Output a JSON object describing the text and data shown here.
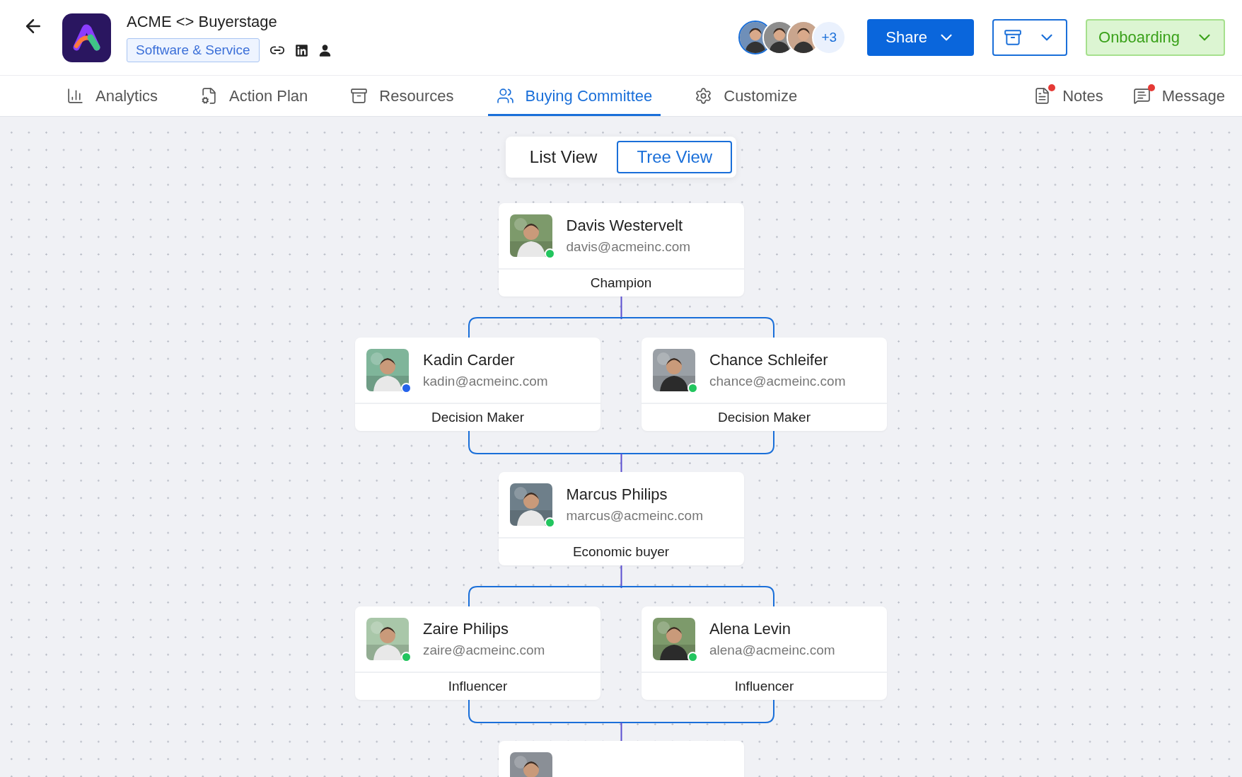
{
  "header": {
    "title": "ACME <> Buyerstage",
    "tag": "Software & Service",
    "collaborators": [
      {
        "kind": "picture"
      },
      {
        "kind": "picture"
      },
      {
        "kind": "picture"
      }
    ],
    "collaborators_more": "+3",
    "share_button": "Share",
    "stage_button": "Onboarding"
  },
  "tabs": [
    {
      "kind": "analytics",
      "label": "Analytics",
      "selected": false
    },
    {
      "kind": "plan",
      "label": "Action Plan",
      "selected": false
    },
    {
      "kind": "resources",
      "label": "Resources",
      "selected": false
    },
    {
      "kind": "committee",
      "label": "Buying Committee",
      "selected": true
    },
    {
      "kind": "customize",
      "label": "Customize",
      "selected": false
    }
  ],
  "side_tabs": [
    {
      "kind": "notes",
      "label": "Notes",
      "unread": true
    },
    {
      "kind": "message",
      "label": "Message",
      "unread": true
    }
  ],
  "view_toggle": [
    {
      "label": "List View",
      "selected": false
    },
    {
      "label": "Tree View",
      "selected": true
    }
  ],
  "tree_levels": [
    {
      "members": [
        {
          "kind": "person",
          "name": "Davis Westervelt",
          "email": "davis@acmeinc.com",
          "role": "Champion",
          "color": "#22c55e"
        }
      ]
    },
    {
      "members": [
        {
          "kind": "person",
          "name": "Kadin Carder",
          "email": "kadin@acmeinc.com",
          "role": "Decision Maker",
          "color": "#2563eb"
        },
        {
          "kind": "person",
          "name": "Chance Schleifer",
          "email": "chance@acmeinc.com",
          "role": "Decision Maker",
          "color": "#22c55e"
        }
      ]
    },
    {
      "members": [
        {
          "kind": "person",
          "name": "Marcus Philips",
          "email": "marcus@acmeinc.com",
          "role": "Economic buyer",
          "color": "#22c55e"
        }
      ]
    },
    {
      "members": [
        {
          "kind": "person",
          "name": "Zaire Philips",
          "email": "zaire@acmeinc.com",
          "role": "Influencer",
          "color": "#22c55e"
        },
        {
          "kind": "person",
          "name": "Alena Levin",
          "email": "alena@acmeinc.com",
          "role": "Influencer",
          "color": "#22c55e"
        }
      ]
    },
    {
      "members": [
        {
          "kind": "picture"
        }
      ]
    }
  ]
}
